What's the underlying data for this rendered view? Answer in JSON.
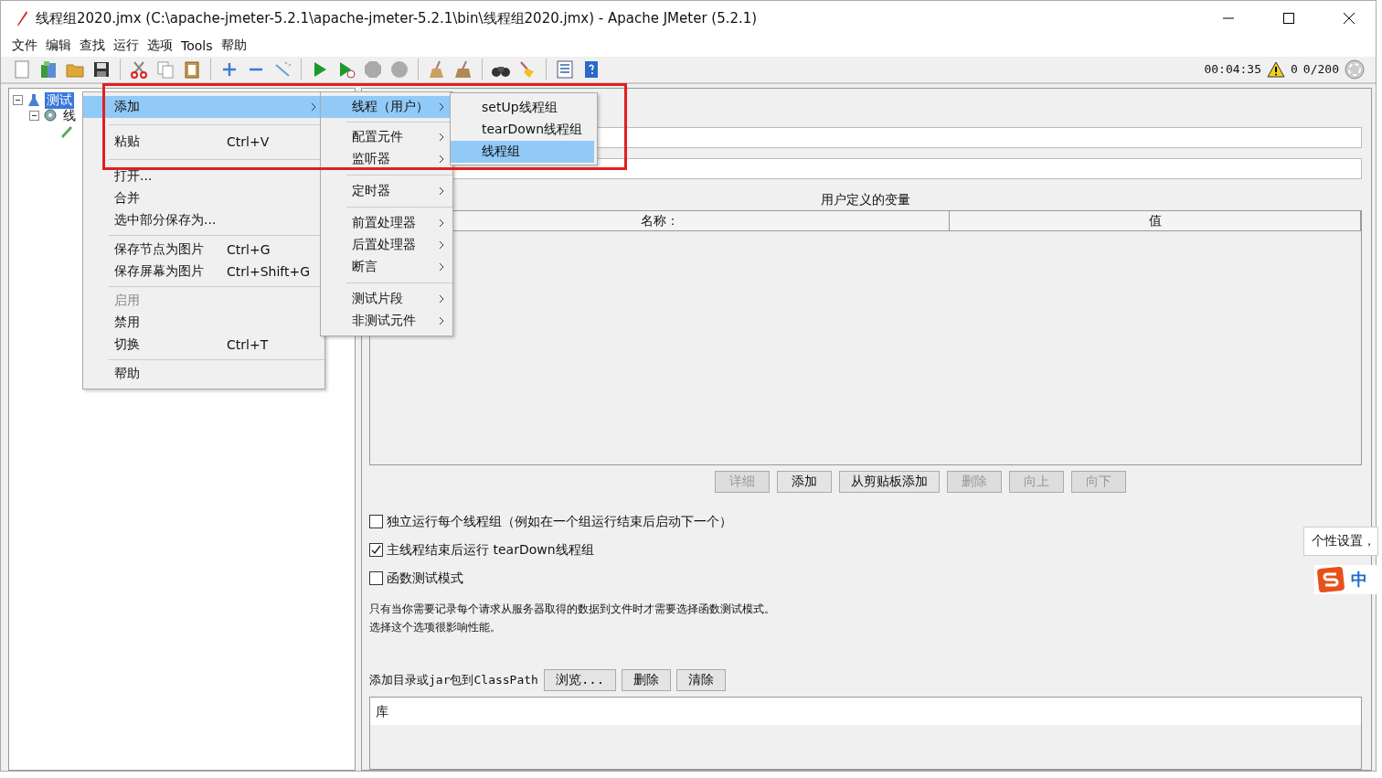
{
  "window": {
    "title": "线程组2020.jmx (C:\\apache-jmeter-5.2.1\\apache-jmeter-5.2.1\\bin\\线程组2020.jmx) - Apache JMeter (5.2.1)"
  },
  "menu_bar": [
    "文件",
    "编辑",
    "查找",
    "运行",
    "选项",
    "Tools",
    "帮助"
  ],
  "status": {
    "elapsed": "00:04:35",
    "errors": "0",
    "threads": "0/200"
  },
  "tree": [
    {
      "label": "测试",
      "selected": true,
      "children": [
        {
          "label": "线",
          "selected": false,
          "children": [
            {
              "selected": false
            }
          ]
        }
      ]
    }
  ],
  "form": {
    "variables_title": "用户定义的变量",
    "table": {
      "columns": [
        "名称：",
        "值"
      ]
    },
    "buttons": [
      {
        "label": "详细",
        "disabled": true
      },
      {
        "label": "添加",
        "disabled": false
      },
      {
        "label": "从剪贴板添加",
        "disabled": false
      },
      {
        "label": "删除",
        "disabled": true
      },
      {
        "label": "向上",
        "disabled": true
      },
      {
        "label": "向下",
        "disabled": true
      }
    ],
    "options": [
      {
        "label": "独立运行每个线程组（例如在一个组运行结束后启动下一个）",
        "checked": false
      },
      {
        "label": "主线程结束后运行 tearDown线程组",
        "checked": true
      },
      {
        "label": "函数测试模式",
        "checked": false
      }
    ],
    "note": [
      "只有当你需要记录每个请求从服务器取得的数据到文件时才需要选择函数测试模式。",
      "选择这个选项很影响性能。"
    ],
    "classpath": {
      "label": "添加目录或jar包到ClassPath",
      "buttons": [
        "浏览...",
        "删除",
        "清除"
      ],
      "list_header": "库"
    }
  },
  "context_menu": [
    {
      "kind": "item",
      "label": "添加",
      "submenu": true,
      "selected": true,
      "disabled": false
    },
    {
      "kind": "separator"
    },
    {
      "kind": "item",
      "label": "粘贴",
      "shortcut": "Ctrl+V",
      "submenu": false,
      "selected": false,
      "disabled": false
    },
    {
      "kind": "separator"
    },
    {
      "kind": "item",
      "label": "打开...",
      "submenu": false,
      "selected": false,
      "disabled": false
    },
    {
      "kind": "item",
      "label": "合并",
      "submenu": false,
      "selected": false,
      "disabled": false
    },
    {
      "kind": "item",
      "label": "选中部分保存为...",
      "submenu": false,
      "selected": false,
      "disabled": false
    },
    {
      "kind": "separator"
    },
    {
      "kind": "item",
      "label": "保存节点为图片",
      "shortcut": "Ctrl+G",
      "submenu": false,
      "selected": false,
      "disabled": false
    },
    {
      "kind": "item",
      "label": "保存屏幕为图片",
      "shortcut": "Ctrl+Shift+G",
      "submenu": false,
      "selected": false,
      "disabled": false
    },
    {
      "kind": "separator"
    },
    {
      "kind": "item",
      "label": "启用",
      "submenu": false,
      "selected": false,
      "disabled": true
    },
    {
      "kind": "item",
      "label": "禁用",
      "submenu": false,
      "selected": false,
      "disabled": false
    },
    {
      "kind": "item",
      "label": "切换",
      "shortcut": "Ctrl+T",
      "submenu": false,
      "selected": false,
      "disabled": false
    },
    {
      "kind": "separator"
    },
    {
      "kind": "item",
      "label": "帮助",
      "submenu": false,
      "selected": false,
      "disabled": false
    }
  ],
  "add_submenu": [
    {
      "kind": "item",
      "label": "线程（用户）",
      "selected": true
    },
    {
      "kind": "separator"
    },
    {
      "kind": "item",
      "label": "配置元件",
      "selected": false
    },
    {
      "kind": "item",
      "label": "监听器",
      "selected": false
    },
    {
      "kind": "separator"
    },
    {
      "kind": "item",
      "label": "定时器",
      "selected": false
    },
    {
      "kind": "separator"
    },
    {
      "kind": "item",
      "label": "前置处理器",
      "selected": false
    },
    {
      "kind": "item",
      "label": "后置处理器",
      "selected": false
    },
    {
      "kind": "item",
      "label": "断言",
      "selected": false
    },
    {
      "kind": "separator"
    },
    {
      "kind": "item",
      "label": "测试片段",
      "selected": false
    },
    {
      "kind": "item",
      "label": "非测试元件",
      "selected": false
    }
  ],
  "threads_submenu": [
    {
      "label": "setUp线程组",
      "selected": false
    },
    {
      "label": "tearDown线程组",
      "selected": false
    },
    {
      "label": "线程组",
      "selected": true
    }
  ],
  "ime": {
    "tooltip": "个性设置，",
    "mode": "中"
  }
}
